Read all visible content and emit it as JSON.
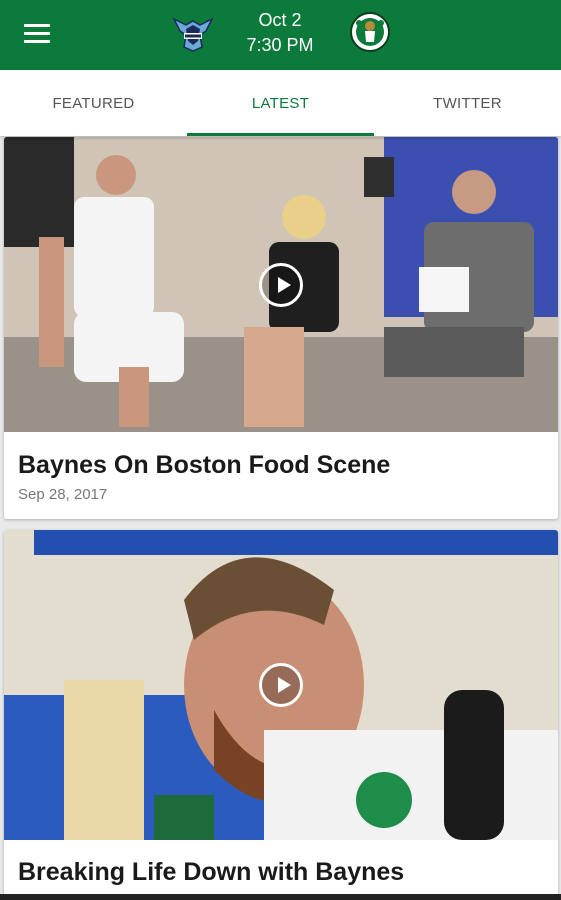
{
  "header": {
    "menu_icon": "hamburger-menu-icon",
    "away_team_logo": "hornets-logo",
    "home_team_logo": "celtics-logo",
    "game_date": "Oct 2",
    "game_time": "7:30 PM",
    "accent_color": "#0b7a3a"
  },
  "tabs": [
    {
      "label": "FEATURED",
      "active": false
    },
    {
      "label": "LATEST",
      "active": true
    },
    {
      "label": "TWITTER",
      "active": false
    }
  ],
  "feed": {
    "items": [
      {
        "title": "Baynes On Boston Food Scene",
        "date": "Sep 28, 2017",
        "media": "video",
        "play_icon": "play-icon"
      },
      {
        "title": "Breaking Life Down with Baynes",
        "media": "video",
        "play_icon": "play-icon"
      }
    ]
  }
}
